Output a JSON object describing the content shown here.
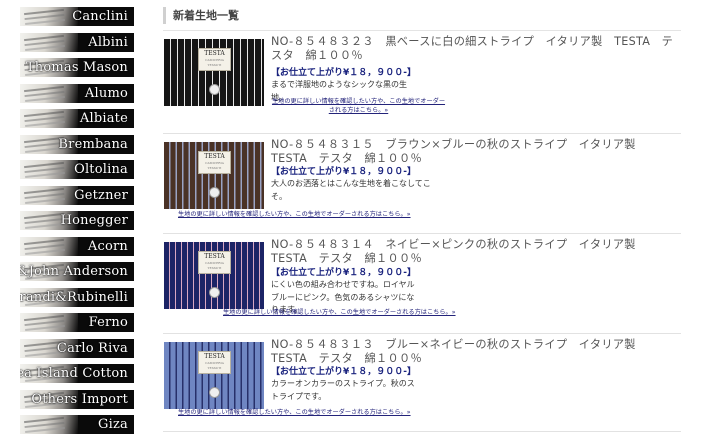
{
  "sidebar": {
    "brands": [
      {
        "name": "Canclini"
      },
      {
        "name": "Albini"
      },
      {
        "name": "Thomas Mason"
      },
      {
        "name": "Alumo"
      },
      {
        "name": "Albiate"
      },
      {
        "name": "Brembana"
      },
      {
        "name": "Oltolina"
      },
      {
        "name": "Getzner"
      },
      {
        "name": "Honegger"
      },
      {
        "name": "Acorn"
      },
      {
        "name": "David&John Anderson"
      },
      {
        "name": "Girandi&Rubinelli"
      },
      {
        "name": "Ferno"
      },
      {
        "name": "Carlo Riva"
      },
      {
        "name": "Sea Island Cotton"
      },
      {
        "name": "Others Import"
      },
      {
        "name": "Giza"
      }
    ]
  },
  "main": {
    "heading": "新着生地一覧",
    "items": [
      {
        "title": "NO-８５４８３２３　黒ベースに白の細ストライプ　イタリア製　TESTA　テスタ　綿１００％",
        "price": "【お仕立て上がり¥１８，９００-】",
        "description": "まるで洋服地のようなシックな黒の生地。",
        "more_link": "生地の更に詳しい情報を確認したい方や、この生地でオーダーされる方はこちら。»",
        "swatch_tag": "TESTA",
        "swatch_tag_sub": "CAMICERIA TESSUTI",
        "swatch_colors": {
          "base": "#151515",
          "stripe": "#e8e8e8"
        }
      },
      {
        "title": "NO-８５４８３１５　ブラウン×ブルーの秋のストライプ　イタリア製　TESTA　テスタ　綿１００％",
        "price": "【お仕立て上がり¥１８，９００-】",
        "description": "大人のお洒落とはこんな生地を着こなしてこそ。",
        "more_link": "生地の更に詳しい情報を確認したい方や、この生地でオーダーされる方はこちら。»",
        "swatch_tag": "TESTA",
        "swatch_tag_sub": "CAMICERIA TESSUTI",
        "swatch_colors": {
          "base": "#4a3226",
          "stripe": "#9aa3c4"
        }
      },
      {
        "title": "NO-８５４８３１４　ネイビー×ピンクの秋のストライプ　イタリア製　TESTA　テスタ　綿１００％",
        "price": "【お仕立て上がり¥１８，９００-】",
        "description": "にくい色の組み合わせですね。ロイヤルブルーにピンク。色気のあるシャツになります。",
        "more_link": "生地の更に詳しい情報を確認したい方や、この生地でオーダーされる方はこちら。»",
        "swatch_tag": "TESTA",
        "swatch_tag_sub": "CAMICERIA TESSUTI",
        "swatch_colors": {
          "base": "#1c2466",
          "stripe": "#d9a7c2"
        }
      },
      {
        "title": "NO-８５４８３１３　ブルー×ネイビーの秋のストライプ　イタリア製　TESTA　テスタ　綿１００％",
        "price": "【お仕立て上がり¥１８，９００-】",
        "description": "カラーオンカラーのストライプ。秋のストライプです。",
        "more_link": "生地の更に詳しい情報を確認したい方や、この生地でオーダーされる方はこちら。»",
        "swatch_tag": "TESTA",
        "swatch_tag_sub": "CAMICERIA TESSUTI",
        "swatch_colors": {
          "base": "#6f86c2",
          "stripe": "#27306a"
        }
      }
    ]
  }
}
